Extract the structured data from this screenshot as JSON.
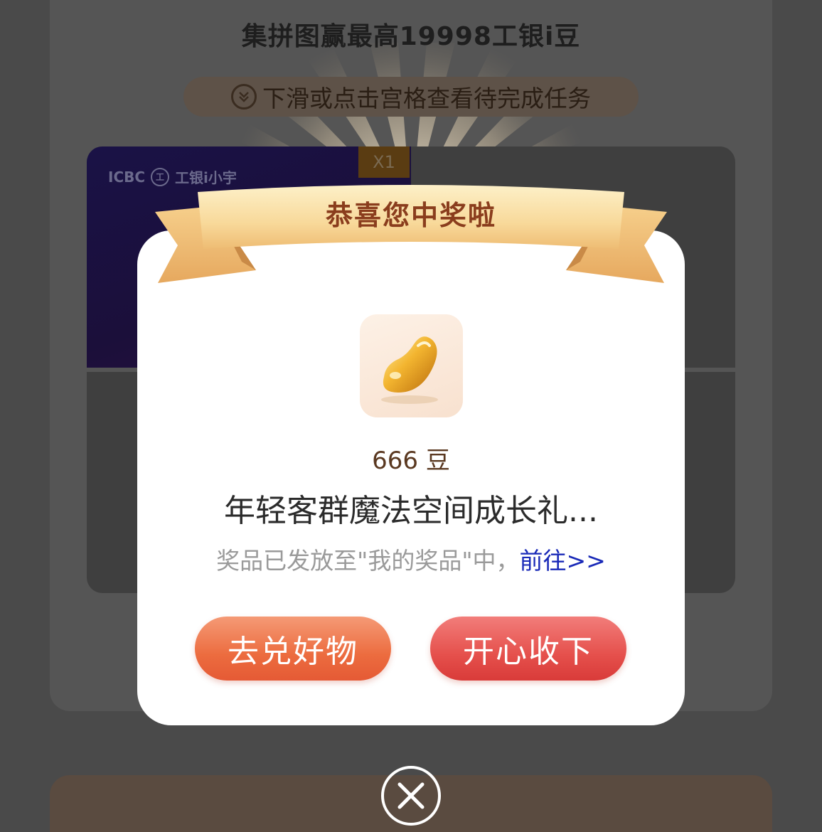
{
  "background": {
    "title": "集拼图赢最高19998工银i豆",
    "hint": "下滑或点击宫格查看待完成任务",
    "logo_text": "ICBC",
    "logo_sub": "工银i小宇",
    "badge": "X1"
  },
  "modal": {
    "ribbon_title": "恭喜您中奖啦",
    "prize_amount": "666 豆",
    "prize_name": "年轻客群魔法空间成长礼...",
    "note_prefix": "奖品已发放至\"我的奖品\"中，",
    "note_link": "前往>>",
    "button_exchange": "去兑好物",
    "button_accept": "开心收下"
  },
  "icons": [
    "chevron-double-down-icon",
    "icbc-logo-icon",
    "golden-bean-icon",
    "close-icon"
  ]
}
